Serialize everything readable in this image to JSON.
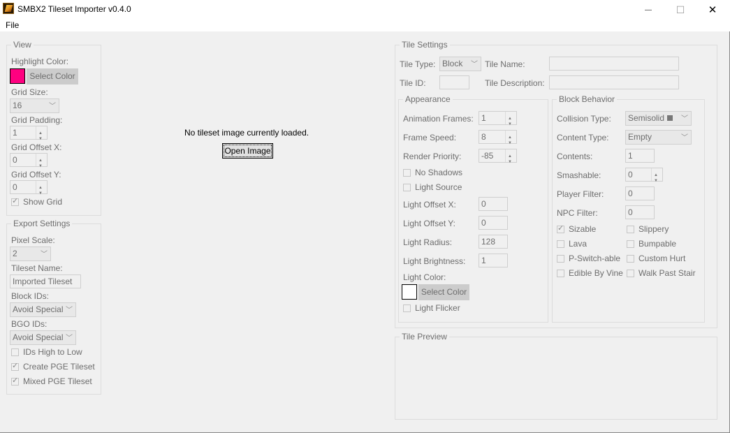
{
  "window": {
    "title": "SMBX2 Tileset Importer v0.4.0",
    "minimize_glyph": "—",
    "maximize_glyph": "☐",
    "close_glyph": "✕"
  },
  "menu": {
    "file": "File"
  },
  "view": {
    "legend": "View",
    "highlight_color_label": "Highlight Color:",
    "highlight_color": "#ff0080",
    "select_color_button": "Select Color",
    "grid_size_label": "Grid Size:",
    "grid_size_value": "16",
    "grid_padding_label": "Grid Padding:",
    "grid_padding_value": "1",
    "grid_offset_x_label": "Grid Offset X:",
    "grid_offset_x_value": "0",
    "grid_offset_y_label": "Grid Offset Y:",
    "grid_offset_y_value": "0",
    "show_grid_label": "Show Grid",
    "show_grid_checked": true
  },
  "export": {
    "legend": "Export Settings",
    "pixel_scale_label": "Pixel Scale:",
    "pixel_scale_value": "2",
    "tileset_name_label": "Tileset Name:",
    "tileset_name_value": "Imported Tileset",
    "block_ids_label": "Block IDs:",
    "block_ids_value": "Avoid Special",
    "bgo_ids_label": "BGO IDs:",
    "bgo_ids_value": "Avoid Special",
    "ids_high_to_low_label": "IDs High to Low",
    "create_pge_label": "Create PGE Tileset",
    "mixed_pge_label": "Mixed PGE Tileset"
  },
  "center": {
    "message": "No tileset image currently loaded.",
    "open_image_button": "Open Image"
  },
  "tile_settings": {
    "legend": "Tile Settings",
    "tile_type_label": "Tile Type:",
    "tile_type_value": "Block",
    "tile_name_label": "Tile Name:",
    "tile_name_value": "",
    "tile_id_label": "Tile ID:",
    "tile_id_value": "",
    "tile_description_label": "Tile Description:",
    "tile_description_value": ""
  },
  "appearance": {
    "legend": "Appearance",
    "animation_frames_label": "Animation Frames:",
    "animation_frames_value": "1",
    "frame_speed_label": "Frame Speed:",
    "frame_speed_value": "8",
    "render_priority_label": "Render Priority:",
    "render_priority_value": "-85",
    "no_shadows_label": "No Shadows",
    "light_source_label": "Light Source",
    "light_offset_x_label": "Light Offset X:",
    "light_offset_x_value": "0",
    "light_offset_y_label": "Light Offset Y:",
    "light_offset_y_value": "0",
    "light_radius_label": "Light Radius:",
    "light_radius_value": "128",
    "light_brightness_label": "Light Brightness:",
    "light_brightness_value": "1",
    "light_color_label": "Light Color:",
    "light_color": "#ffffff",
    "select_color_button": "Select Color",
    "light_flicker_label": "Light Flicker"
  },
  "block_behavior": {
    "legend": "Block Behavior",
    "collision_type_label": "Collision Type:",
    "collision_type_value": "Semisolid",
    "content_type_label": "Content Type:",
    "content_type_value": "Empty",
    "contents_label": "Contents:",
    "contents_value": "1",
    "smashable_label": "Smashable:",
    "smashable_value": "0",
    "player_filter_label": "Player Filter:",
    "player_filter_value": "0",
    "npc_filter_label": "NPC Filter:",
    "npc_filter_value": "0",
    "sizable_label": "Sizable",
    "slippery_label": "Slippery",
    "lava_label": "Lava",
    "bumpable_label": "Bumpable",
    "pswitch_label": "P-Switch-able",
    "custom_hurt_label": "Custom Hurt",
    "edible_vine_label": "Edible By Vine",
    "walk_past_stair_label": "Walk Past Stair"
  },
  "preview": {
    "legend": "Tile Preview"
  }
}
